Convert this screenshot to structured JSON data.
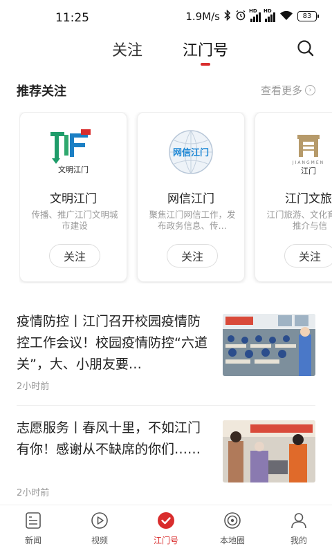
{
  "status_bar": {
    "time": "11:25",
    "speed": "1.9M/s",
    "battery": "83",
    "hd_label": "HD"
  },
  "top_tabs": [
    {
      "label": "关注",
      "active": false
    },
    {
      "label": "江门号",
      "active": true
    }
  ],
  "recommend": {
    "title": "推荐关注",
    "more_label": "查看更多",
    "cards": [
      {
        "logo_text": "文明江门",
        "name": "文明江门",
        "desc": "传播、推广江门文明城市建设",
        "button": "关注"
      },
      {
        "logo_text": "网信江门",
        "name": "网信江门",
        "desc": "聚焦江门网信工作，发布政务信息、传…",
        "button": "关注"
      },
      {
        "logo_text": "江门",
        "logo_sub": "JIANGMEN",
        "name": "江门文旅",
        "desc": "江门旅游、文化育宣传推介与信",
        "button": "关注"
      }
    ]
  },
  "news": [
    {
      "title": "疫情防控丨江门召开校园疫情防控工作会议！校园疫情防控“六道关”，大、小朋友要…",
      "time": "2小时前",
      "thumb_icon": "classroom-photo"
    },
    {
      "title": "志愿服务丨春风十里，不如江门有你！感谢从不缺席的你们……",
      "time": "2小时前",
      "thumb_icon": "volunteer-photo"
    }
  ],
  "bottom_nav": [
    {
      "label": "新闻",
      "icon": "news-icon",
      "active": false
    },
    {
      "label": "视频",
      "icon": "video-icon",
      "active": false
    },
    {
      "label": "江门号",
      "icon": "jiangmenhao-icon",
      "active": true
    },
    {
      "label": "本地圈",
      "icon": "local-circle-icon",
      "active": false
    },
    {
      "label": "我的",
      "icon": "profile-icon",
      "active": false
    }
  ],
  "colors": {
    "accent": "#d92d2d",
    "text": "#222222",
    "muted": "#999999"
  }
}
